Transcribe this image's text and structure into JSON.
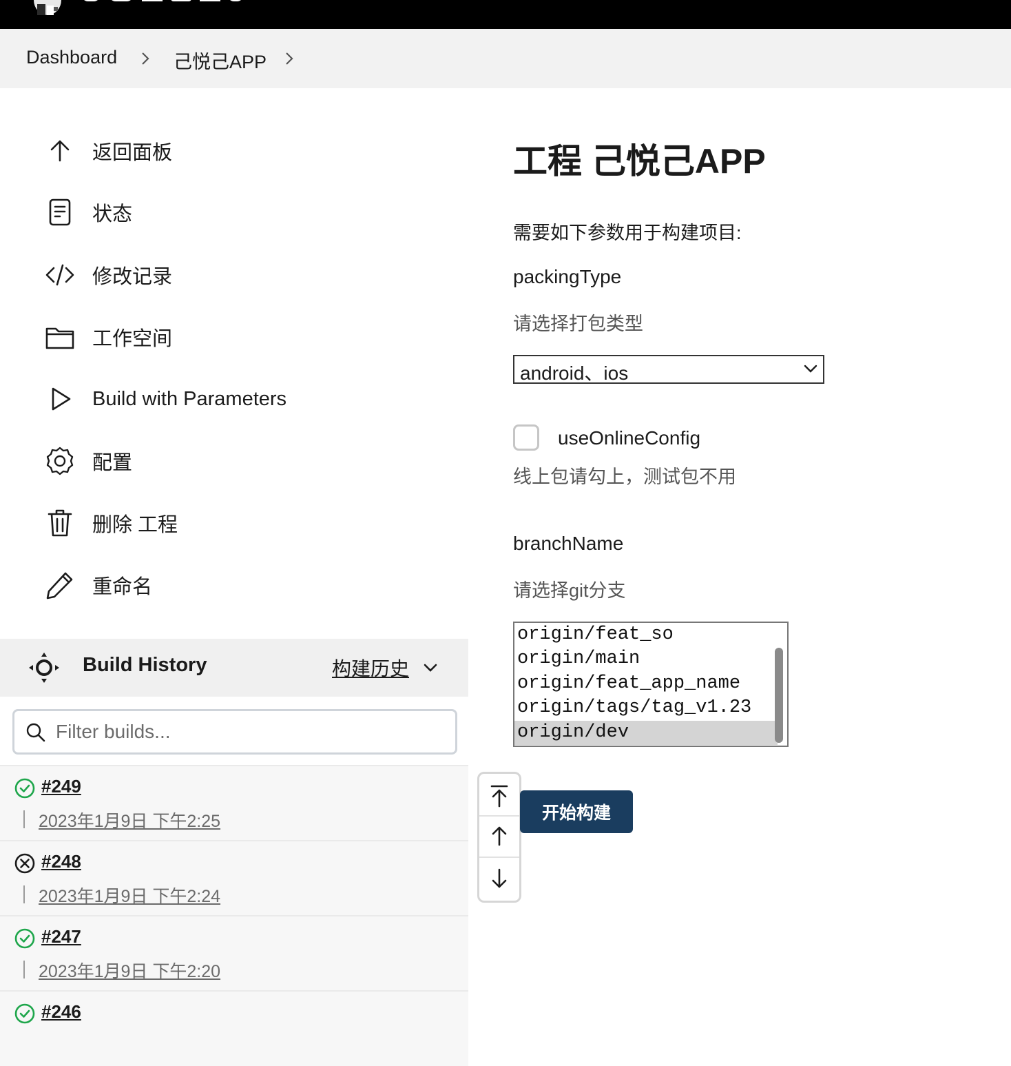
{
  "header": {
    "logo": "jenkins-logo"
  },
  "breadcrumb": {
    "items": [
      "Dashboard",
      "己悦己APP"
    ]
  },
  "sidebar": {
    "items": [
      {
        "label": "返回面板",
        "icon": "arrow-up-icon"
      },
      {
        "label": "状态",
        "icon": "document-icon"
      },
      {
        "label": "修改记录",
        "icon": "code-icon"
      },
      {
        "label": "工作空间",
        "icon": "folder-icon"
      },
      {
        "label": "Build with Parameters",
        "icon": "play-icon"
      },
      {
        "label": "配置",
        "icon": "gear-icon"
      },
      {
        "label": "删除 工程",
        "icon": "trash-icon"
      },
      {
        "label": "重命名",
        "icon": "pencil-icon"
      }
    ]
  },
  "build_history": {
    "title": "Build History",
    "link": "构建历史",
    "filter_placeholder": "Filter builds...",
    "builds": [
      {
        "number": "#249",
        "date": "2023年1月9日 下午2:25",
        "status": "success"
      },
      {
        "number": "#248",
        "date": "2023年1月9日 下午2:24",
        "status": "failed"
      },
      {
        "number": "#247",
        "date": "2023年1月9日 下午2:20",
        "status": "success"
      },
      {
        "number": "#246",
        "date": "",
        "status": "success"
      }
    ]
  },
  "main": {
    "title": "工程 己悦己APP",
    "description": "需要如下参数用于构建项目:",
    "params": {
      "packingType": {
        "name": "packingType",
        "help": "请选择打包类型",
        "value": "android、ios"
      },
      "useOnlineConfig": {
        "name": "useOnlineConfig",
        "help": "线上包请勾上，测试包不用",
        "checked": false
      },
      "branchName": {
        "name": "branchName",
        "help": "请选择git分支",
        "options": [
          "origin/feat_so",
          "origin/main",
          "origin/feat_app_name",
          "origin/tags/tag_v1.23",
          "origin/dev"
        ],
        "selected": "origin/dev"
      }
    },
    "build_button": "开始构建"
  },
  "colors": {
    "primary_button": "#1a3d5f",
    "success": "#1ea64b",
    "failed": "#1b1b1b"
  }
}
